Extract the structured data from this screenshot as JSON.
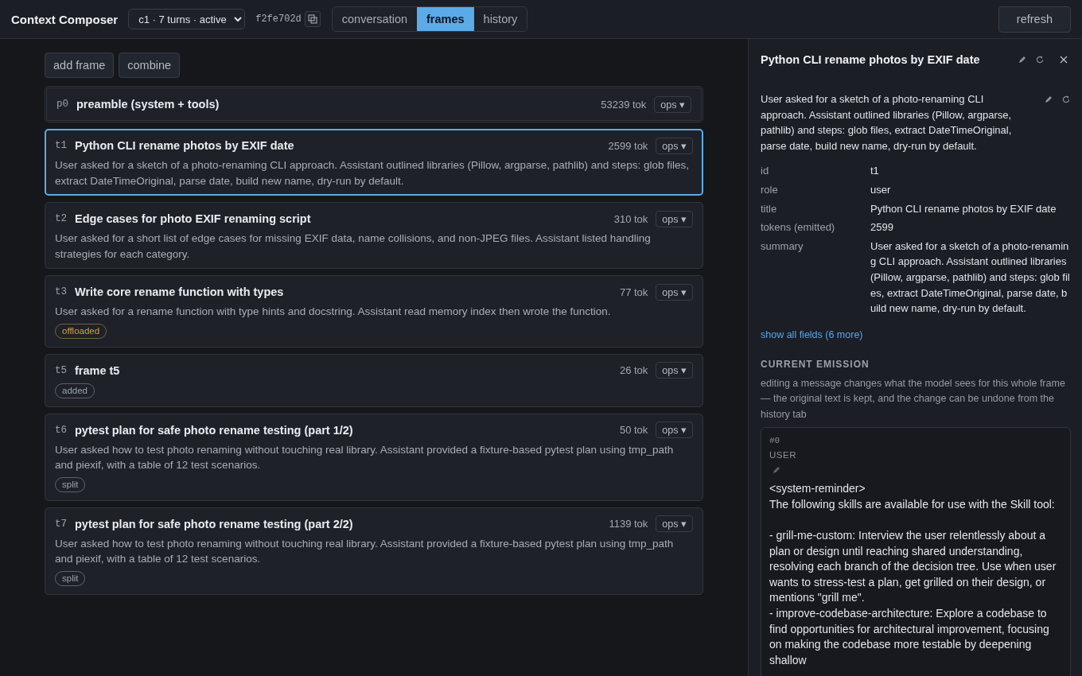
{
  "header": {
    "title": "Context Composer",
    "conversation_select": {
      "value": "c1 · 7 turns · active"
    },
    "hash": "f2fe702d",
    "tabs": [
      {
        "label": "conversation",
        "selected": false
      },
      {
        "label": "frames",
        "selected": true
      },
      {
        "label": "history",
        "selected": false
      }
    ],
    "refresh_button": "refresh"
  },
  "toolbar": {
    "buttons": [
      {
        "label": "add frame"
      },
      {
        "label": "combine"
      }
    ]
  },
  "frames": [
    {
      "kind": "preamble",
      "id": "p0",
      "title": "preamble (system + tools)",
      "tokens": "53239 tok",
      "ops": "ops ▾",
      "selected": false
    },
    {
      "kind": "turn",
      "id": "t1",
      "title": "Python CLI rename photos by EXIF date",
      "tokens": "2599 tok",
      "ops": "ops ▾",
      "selected": true,
      "summary": "User asked for a sketch of a photo-renaming CLI approach. Assistant outlined libraries (Pillow, argparse, pathlib) and steps: glob files, extract DateTimeOriginal, parse date, build new name, dry-run by default."
    },
    {
      "kind": "turn",
      "id": "t2",
      "title": "Edge cases for photo EXIF renaming script",
      "tokens": "310 tok",
      "ops": "ops ▾",
      "selected": false,
      "summary": "User asked for a short list of edge cases for missing EXIF data, name collisions, and non-JPEG files. Assistant listed handling strategies for each category."
    },
    {
      "kind": "turn",
      "id": "t3",
      "title": "Write core rename function with types",
      "tokens": "77 tok",
      "ops": "ops ▾",
      "selected": false,
      "summary": "User asked for a rename function with type hints and docstring. Assistant read memory index then wrote the function.",
      "tags": [
        {
          "label": "offloaded",
          "color": "#d4a23c"
        }
      ]
    },
    {
      "kind": "turn",
      "id": "t5",
      "title": "frame t5",
      "tokens": "26 tok",
      "ops": "ops ▾",
      "selected": false,
      "tags": [
        {
          "label": "added",
          "color": "#9ba2ac"
        }
      ]
    },
    {
      "kind": "turn",
      "id": "t6",
      "title": "pytest plan for safe photo rename testing (part 1/2)",
      "tokens": "50 tok",
      "ops": "ops ▾",
      "selected": false,
      "summary": "User asked how to test photo renaming without touching real library. Assistant provided a fixture-based pytest plan using tmp_path and piexif, with a table of 12 test scenarios.",
      "tags": [
        {
          "label": "split",
          "color": "#9ba2ac"
        }
      ]
    },
    {
      "kind": "turn",
      "id": "t7",
      "title": "pytest plan for safe photo rename testing (part 2/2)",
      "tokens": "1139 tok",
      "ops": "ops ▾",
      "selected": false,
      "summary": "User asked how to test photo renaming without touching real library. Assistant provided a fixture-based pytest plan using tmp_path and piexif, with a table of 12 test scenarios.",
      "tags": [
        {
          "label": "split",
          "color": "#9ba2ac"
        }
      ]
    }
  ],
  "detail_panel": {
    "title": "Python CLI rename photos by EXIF date",
    "summary": "User asked for a sketch of a photo-renaming CLI approach. Assistant outlined libraries (Pillow, argparse, pathlib) and steps: glob files, extract DateTimeOriginal, parse date, build new name, dry-run by default.",
    "fields": [
      {
        "label": "id",
        "value": "t1"
      },
      {
        "label": "role",
        "value": "user"
      },
      {
        "label": "title",
        "value": "Python CLI rename photos by EXIF date"
      },
      {
        "label": "tokens (emitted)",
        "value": "2599"
      },
      {
        "label": "summary",
        "value": "User asked for a sketch of a photo-renaming CLI approach. Assistant outlined libraries (Pillow, argparse, pathlib) and steps: glob files, extract DateTimeOriginal, parse date, build new name, dry-run by default."
      }
    ],
    "show_all_link": "show all fields (6 more)",
    "emission": {
      "heading": "CURRENT EMISSION",
      "note": "editing a message changes what the model sees for this whole frame — the original text is kept, and the change can be undone from the history tab",
      "message": {
        "index": "#0",
        "role": "USER",
        "text": "<system-reminder>\nThe following skills are available for use with the Skill tool:\n\n- grill-me-custom: Interview the user relentlessly about a plan or design until reaching shared understanding, resolving each branch of the decision tree. Use when user wants to stress-test a plan, get grilled on their design, or mentions \"grill me\".\n- improve-codebase-architecture: Explore a codebase to find opportunities for architectural improvement, focusing on making the codebase more testable by deepening shallow"
      }
    }
  }
}
